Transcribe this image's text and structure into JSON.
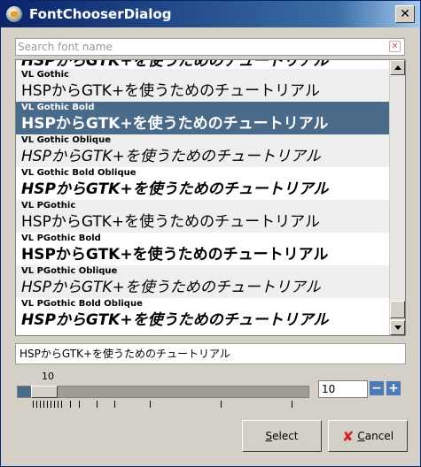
{
  "window": {
    "title": "FontChooserDialog"
  },
  "search": {
    "placeholder": "Search font name"
  },
  "list": {
    "top_partial": "HSPからGTK+を使うためのチュートリアル",
    "items": [
      {
        "name": "VL Gothic",
        "sample": "HSPからGTK+を使うためのチュートリアル"
      },
      {
        "name": "VL Gothic Bold",
        "sample": "HSPからGTK+を使うためのチュートリアル"
      },
      {
        "name": "VL Gothic Oblique",
        "sample": "HSPからGTK+を使うためのチュートリアル"
      },
      {
        "name": "VL Gothic Bold Oblique",
        "sample": "HSPからGTK+を使うためのチュートリアル"
      },
      {
        "name": "VL PGothic",
        "sample": "HSPからGTK+を使うためのチュートリアル"
      },
      {
        "name": "VL PGothic Bold",
        "sample": "HSPからGTK+を使うためのチュートリアル"
      },
      {
        "name": "VL PGothic Oblique",
        "sample": "HSPからGTK+を使うためのチュートリアル"
      },
      {
        "name": "VL PGothic Bold Oblique",
        "sample": "HSPからGTK+を使うためのチュートリアル"
      }
    ],
    "selected": "VL Gothic Bold"
  },
  "preview": {
    "text": "HSPからGTK+を使うためのチュートリアル"
  },
  "size": {
    "slider_label": "10",
    "value": "10",
    "slider_fraction": 0.05
  },
  "buttons": {
    "select_mnemonic": "S",
    "select_rest": "elect",
    "cancel_mnemonic": "C",
    "cancel_rest": "ancel"
  },
  "colors": {
    "selection": "#4a6a8a",
    "titlebar": "#0a246a"
  }
}
